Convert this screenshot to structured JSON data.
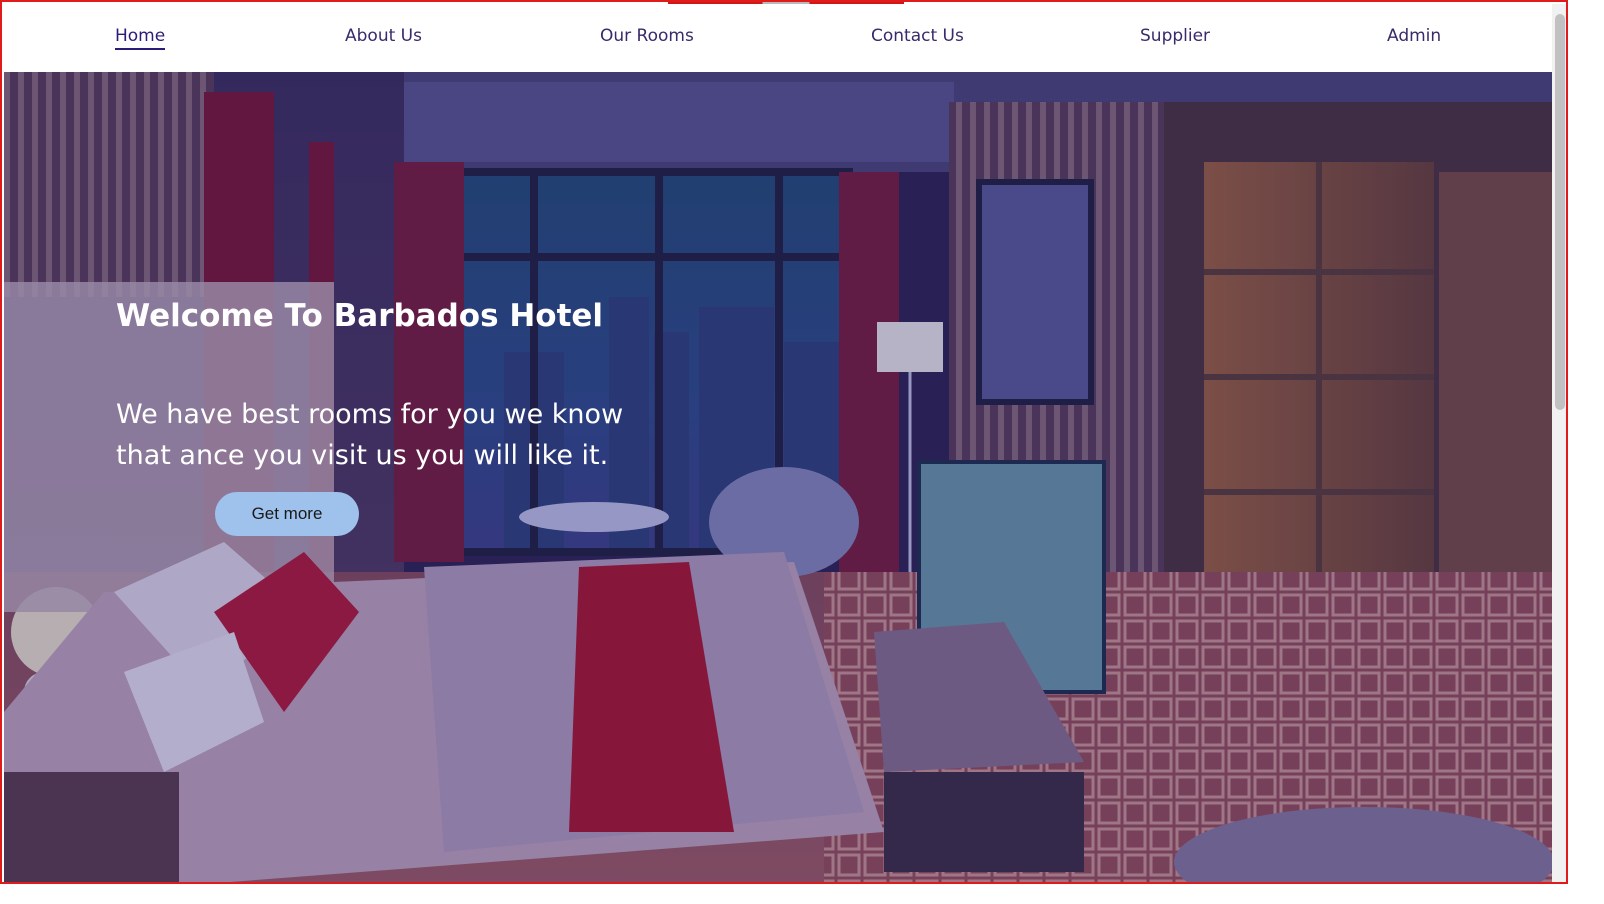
{
  "nav": {
    "items": [
      {
        "label": "Home",
        "active": true
      },
      {
        "label": "About Us"
      },
      {
        "label": "Our Rooms"
      },
      {
        "label": "Contact Us"
      },
      {
        "label": "Supplier"
      },
      {
        "label": "Admin"
      }
    ]
  },
  "hero": {
    "title": "Welcome To Barbados Hotel",
    "text": "We have best rooms for you we know that ance you visit us you will like it.",
    "button_label": "Get more"
  },
  "colors": {
    "nav_text": "#3a2a6a",
    "button_bg": "#9fc2ec",
    "frame_border": "#e01b1b"
  }
}
